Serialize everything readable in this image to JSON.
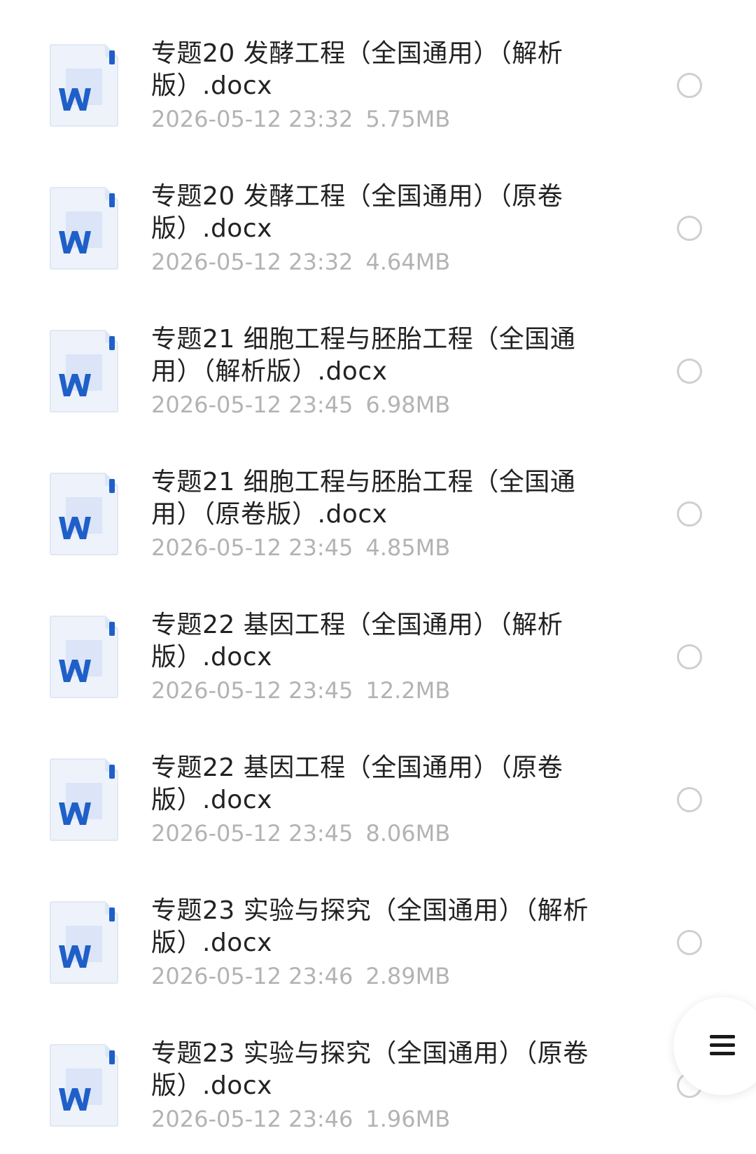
{
  "files": [
    {
      "name": "专题20 发酵工程（全国通用）（解析版）.docx",
      "date": "2026-05-12 23:32",
      "size": "5.75MB",
      "icon": "word-doc-icon",
      "selected": false
    },
    {
      "name": "专题20 发酵工程（全国通用）（原卷版）.docx",
      "date": "2026-05-12 23:32",
      "size": "4.64MB",
      "icon": "word-doc-icon",
      "selected": false
    },
    {
      "name": "专题21 细胞工程与胚胎工程（全国通用）（解析版）.docx",
      "date": "2026-05-12 23:45",
      "size": "6.98MB",
      "icon": "word-doc-icon",
      "selected": false
    },
    {
      "name": "专题21 细胞工程与胚胎工程（全国通用）（原卷版）.docx",
      "date": "2026-05-12 23:45",
      "size": "4.85MB",
      "icon": "word-doc-icon",
      "selected": false
    },
    {
      "name": "专题22 基因工程（全国通用）（解析版）.docx",
      "date": "2026-05-12 23:45",
      "size": "12.2MB",
      "icon": "word-doc-icon",
      "selected": false
    },
    {
      "name": "专题22 基因工程（全国通用）（原卷版）.docx",
      "date": "2026-05-12 23:45",
      "size": "8.06MB",
      "icon": "word-doc-icon",
      "selected": false
    },
    {
      "name": "专题23 实验与探究（全国通用）（解析版）.docx",
      "date": "2026-05-12 23:46",
      "size": "2.89MB",
      "icon": "word-doc-icon",
      "selected": false
    },
    {
      "name": "专题23 实验与探究（全国通用）（原卷版）.docx",
      "date": "2026-05-12 23:46",
      "size": "1.96MB",
      "icon": "word-doc-icon",
      "selected": false
    }
  ],
  "floating_menu": {
    "icon": "menu-icon"
  },
  "colors": {
    "word_blue": "#1f5fc8",
    "icon_paper": "#edf2fb",
    "title_text": "#222222",
    "meta_text": "#b3b3b3",
    "radio_border": "#cfcfcf"
  }
}
